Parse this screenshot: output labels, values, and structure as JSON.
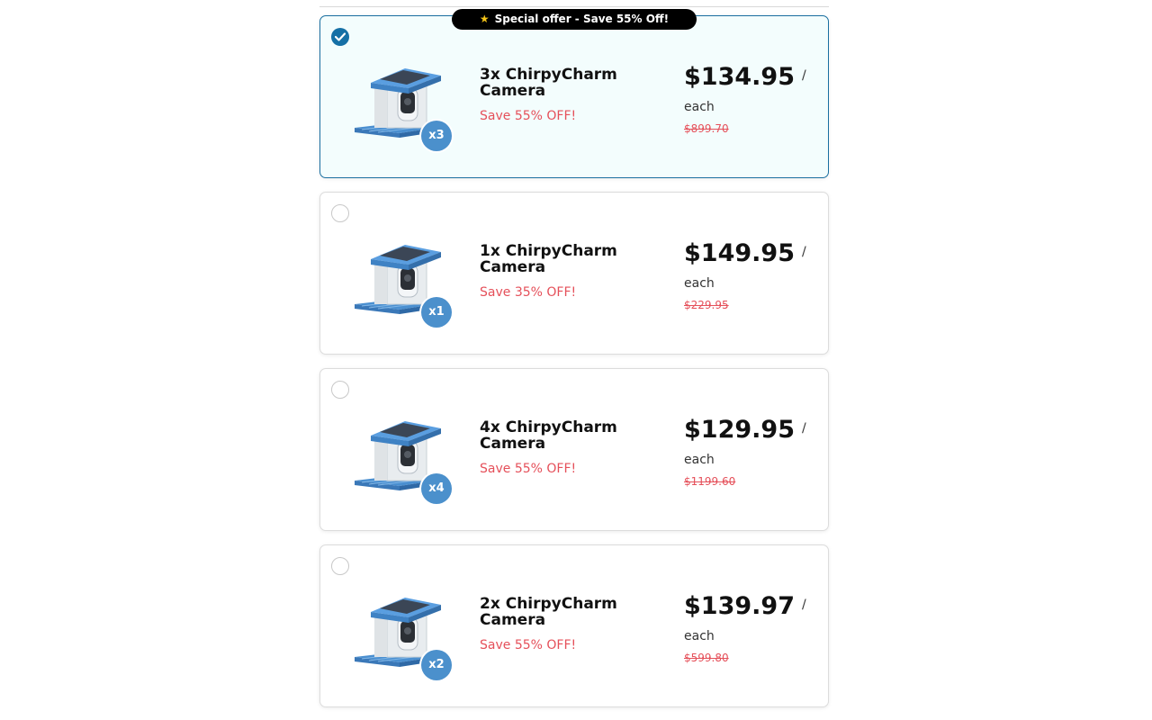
{
  "offer_banner": {
    "text": "Special offer - Save 55% Off!",
    "icon": "star-icon"
  },
  "colors": {
    "selected_border": "#1a6fa0",
    "selected_bg": "#f3fdfd",
    "radio_checked": "#1570a6",
    "badge": "#4b90cc",
    "save_red": "#e5505a"
  },
  "packages": [
    {
      "selected": true,
      "qty_badge": "x3",
      "title": "3x ChirpyCharm Camera",
      "save": "Save 55% OFF!",
      "price": "$134.95",
      "slash": "/",
      "unit": "each",
      "old_price": "$899.70"
    },
    {
      "selected": false,
      "qty_badge": "x1",
      "title": "1x ChirpyCharm Camera",
      "save": "Save 35% OFF!",
      "price": "$149.95",
      "slash": "/",
      "unit": "each",
      "old_price": "$229.95"
    },
    {
      "selected": false,
      "qty_badge": "x4",
      "title": "4x ChirpyCharm Camera",
      "save": "Save 55% OFF!",
      "price": "$129.95",
      "slash": "/",
      "unit": "each",
      "old_price": "$1199.60"
    },
    {
      "selected": false,
      "qty_badge": "x2",
      "title": "2x ChirpyCharm Camera",
      "save": "Save 55% OFF!",
      "price": "$139.97",
      "slash": "/",
      "unit": "each",
      "old_price": "$599.80"
    }
  ]
}
